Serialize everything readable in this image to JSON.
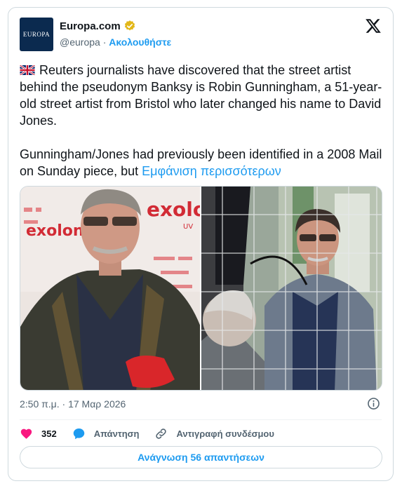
{
  "author": {
    "display_name": "Europa.com",
    "handle": "@europa",
    "separator": " · ",
    "follow_label": "Ακολουθήστε",
    "avatar_text": "EUROPA"
  },
  "tweet": {
    "paragraph_1": "Reuters journalists have discovered that the street artist behind the pseudonym Banksy is Robin Gunningham, a 51-year-old street artist from Bristol who later changed his name to David Jones.",
    "paragraph_2": "Gunningham/Jones had previously been identified in a 2008 Mail on Sunday piece, but ",
    "show_more": "Εμφάνιση περισσότερων",
    "timestamp": "2:50 π.μ. · 17 Μαρ 2026",
    "left_photo_sign_1": "exolon",
    "left_photo_sign_2": "exolon",
    "left_photo_sign_3": "UV"
  },
  "actions": {
    "like_count": "352",
    "reply_label": "Απάντηση",
    "copy_link_label": "Αντιγραφή συνδέσμου"
  },
  "read_replies_label": "Ανάγνωση 56 απαντήσεων",
  "colors": {
    "accent": "#1d9bf0",
    "like": "#f91880",
    "verified_gold": "#e2b719",
    "avatar_bg": "#0b2a4f"
  },
  "icons": [
    "verified-badge-icon",
    "x-logo-icon",
    "uk-flag-icon",
    "info-icon",
    "heart-icon",
    "reply-icon",
    "link-icon"
  ]
}
